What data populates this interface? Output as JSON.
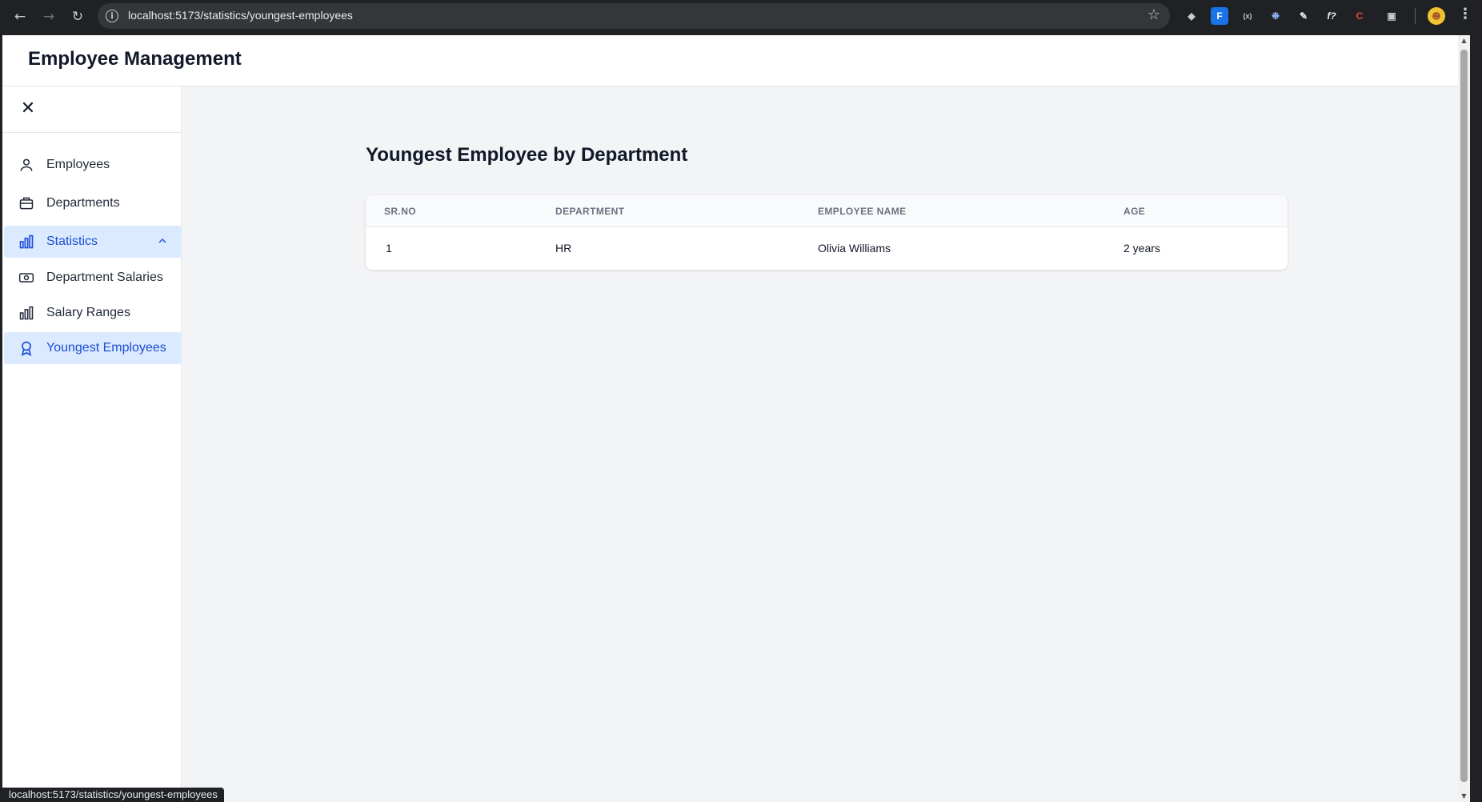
{
  "browser": {
    "url": "localhost:5173/statistics/youngest-employees"
  },
  "app": {
    "title": "Employee Management"
  },
  "sidebar": {
    "items": [
      {
        "label": "Employees"
      },
      {
        "label": "Departments"
      },
      {
        "label": "Statistics"
      },
      {
        "label": "Department Salaries"
      },
      {
        "label": "Salary Ranges"
      },
      {
        "label": "Youngest Employees"
      }
    ]
  },
  "main": {
    "title": "Youngest Employee by Department",
    "table": {
      "headers": [
        "SR.NO",
        "DEPARTMENT",
        "EMPLOYEE NAME",
        "AGE"
      ],
      "rows": [
        [
          "1",
          "HR",
          "Olivia Williams",
          "2 years"
        ]
      ]
    }
  },
  "status_bar": {
    "hover_url": "localhost:5173/statistics/youngest-employees"
  },
  "colors": {
    "accent": "#1d4ed8",
    "active_bg": "#dbeafe",
    "page_bg": "#f3f4f6"
  }
}
